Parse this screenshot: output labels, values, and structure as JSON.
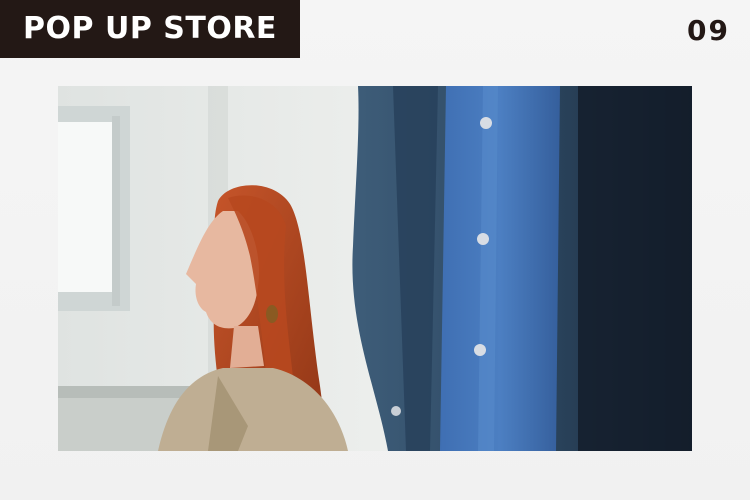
{
  "header": {
    "badge_label": "POP UP STORE",
    "page_number": "09"
  },
  "colors": {
    "badge_background": "#231815",
    "badge_text": "#ffffff",
    "page_number": "#231815",
    "page_background": "#f3f3f3"
  },
  "photo": {
    "subject": "woman-and-blue-shirt-icon"
  }
}
